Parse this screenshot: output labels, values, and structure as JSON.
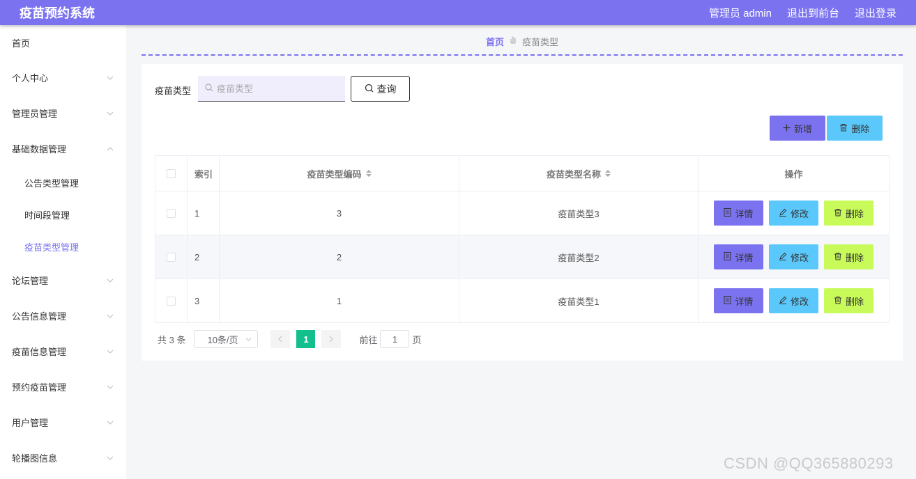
{
  "header": {
    "title": "疫苗预约系统",
    "admin_label": "管理员 admin",
    "back_label": "退出到前台",
    "logout_label": "退出登录",
    "color": "#7b72f0"
  },
  "sidebar": {
    "home": "首页",
    "items": [
      {
        "label": "个人中心",
        "expanded": false
      },
      {
        "label": "管理员管理",
        "expanded": false
      },
      {
        "label": "基础数据管理",
        "expanded": true
      },
      {
        "label": "论坛管理",
        "expanded": false
      },
      {
        "label": "公告信息管理",
        "expanded": false
      },
      {
        "label": "疫苗信息管理",
        "expanded": false
      },
      {
        "label": "预约疫苗管理",
        "expanded": false
      },
      {
        "label": "用户管理",
        "expanded": false
      },
      {
        "label": "轮播图信息",
        "expanded": false
      }
    ],
    "subitems": [
      {
        "label": "公告类型管理",
        "active": false
      },
      {
        "label": "时间段管理",
        "active": false
      },
      {
        "label": "疫苗类型管理",
        "active": true
      }
    ]
  },
  "breadcrumb": {
    "home": "首页",
    "current": "疫苗类型"
  },
  "search": {
    "label": "疫苗类型",
    "placeholder": "疫苗类型",
    "value": "",
    "button": "查询"
  },
  "actions": {
    "add": "新增",
    "delete": "删除"
  },
  "table": {
    "headers": {
      "index": "索引",
      "code": "疫苗类型编码",
      "name": "疫苗类型名称",
      "ops": "操作"
    },
    "rows": [
      {
        "index": "1",
        "code": "3",
        "name": "疫苗类型3"
      },
      {
        "index": "2",
        "code": "2",
        "name": "疫苗类型2"
      },
      {
        "index": "3",
        "code": "1",
        "name": "疫苗类型1"
      }
    ],
    "op_labels": {
      "detail": "详情",
      "edit": "修改",
      "delete": "删除"
    }
  },
  "pagination": {
    "total": "共 3 条",
    "page_size": "10条/页",
    "current": "1",
    "goto_label": "前往",
    "goto_value": "1",
    "page_suffix": "页"
  },
  "watermark": "CSDN @QQ365880293"
}
